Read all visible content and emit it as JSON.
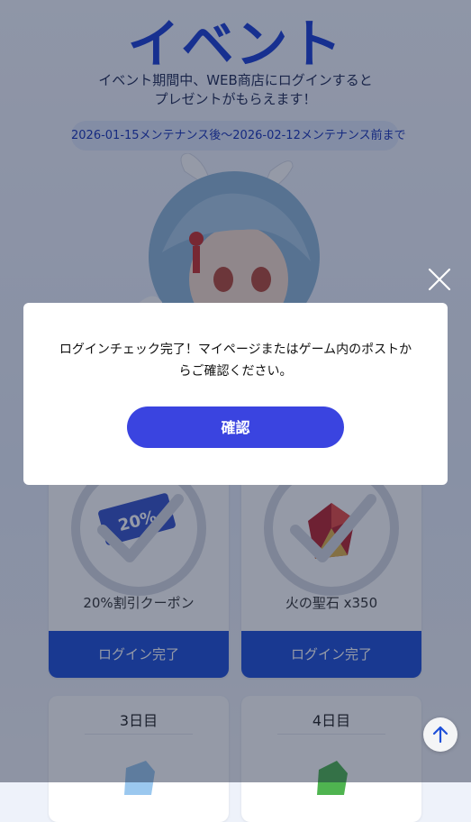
{
  "event": {
    "title": "イベント",
    "description_line1": "イベント期間中、WEB商店にログインすると",
    "description_line2": "プレゼントがもらえます！",
    "period": "2026-01-15メンテナンス後～2026-02-12メンテナンス前まで"
  },
  "rewards": [
    {
      "name": "20%割引クーポン",
      "status": "ログイン完了",
      "icon": "coupon-icon",
      "coupon_text": "20%"
    },
    {
      "name": "火の聖石 x350",
      "status": "ログイン完了",
      "icon": "fire-stone-icon"
    },
    {
      "day": "3日目",
      "icon": "blue-stone-icon"
    },
    {
      "day": "4日目",
      "icon": "green-stone-icon"
    }
  ],
  "modal": {
    "message_line1": "ログインチェック完了！マイページまたはゲーム内のポストか",
    "message_line2": "らご確認ください。",
    "confirm_label": "確認"
  },
  "icons": {
    "close": "close-icon",
    "scroll_top": "arrow-up-icon"
  },
  "colors": {
    "accent": "#3a44e0",
    "title": "#1a3fd6",
    "done_bar": "#1e4fd8"
  }
}
